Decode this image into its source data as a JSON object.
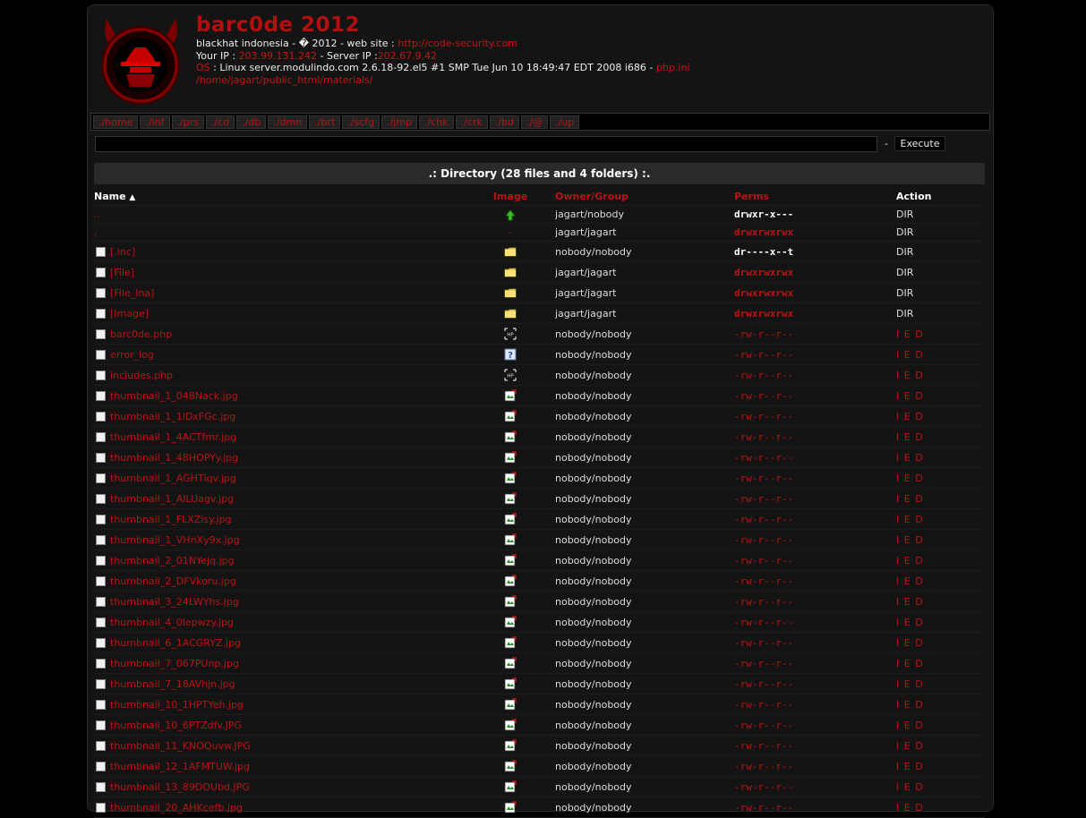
{
  "header": {
    "title": "barc0de 2012",
    "line1_prefix": "blackhat indonesia - � 2012 - web site : ",
    "line1_link": "http://code-security.com",
    "line2_label": "Your IP : ",
    "your_ip": "203.99.131.242",
    "line2_mid": " - Server IP :",
    "server_ip": "202.67.9.42",
    "os_label": "OS",
    "os_text": " : Linux server.modulindo.com 2.6.18-92.el5 #1 SMP Tue Jun 10 18:49:47 EDT 2008 i686 - ",
    "phpini": "php.ini",
    "path": "/home/jagart/public_html/materials/"
  },
  "nav": [
    "./home",
    "./inf",
    "./prs",
    "./cd",
    "./db",
    "./dmn",
    "./brt",
    "./scfg",
    "./jmp",
    "./chk",
    "./crk",
    "./bd",
    "./@",
    "./up"
  ],
  "command": {
    "value": "",
    "dash": "-",
    "execute_label": "Execute"
  },
  "directory_banner": ".: Directory (28 files and 4 folders) :.",
  "columns": {
    "name": "Name",
    "sort_indicator": "▲",
    "image": "Image",
    "owner": "Owner/Group",
    "perms": "Perms",
    "action": "Action"
  },
  "rows": [
    {
      "name": "..",
      "checkbox": false,
      "icon": "up-arrow-icon",
      "owner": "jagart/nobody",
      "perms": "drwxr-x---",
      "perm_style": "w",
      "action": "DIR"
    },
    {
      "name": ".",
      "checkbox": false,
      "icon": "dash",
      "icon_text": "-",
      "owner": "jagart/jagart",
      "perms": "drwxrwxrwx",
      "perm_style": "rb",
      "action": "DIR"
    },
    {
      "name": "[.inc]",
      "checkbox": true,
      "icon": "folder-icon",
      "owner": "nobody/nobody",
      "perms": "dr----x--t",
      "perm_style": "w",
      "action": "DIR"
    },
    {
      "name": "[File]",
      "checkbox": true,
      "icon": "folder-icon",
      "owner": "jagart/jagart",
      "perms": "drwxrwxrwx",
      "perm_style": "rb",
      "action": "DIR"
    },
    {
      "name": "[File_Ina]",
      "checkbox": true,
      "icon": "folder-icon",
      "owner": "jagart/jagart",
      "perms": "drwxrwxrwx",
      "perm_style": "rb",
      "action": "DIR"
    },
    {
      "name": "[Image]",
      "checkbox": true,
      "icon": "folder-icon",
      "owner": "jagart/jagart",
      "perms": "drwxrwxrwx",
      "perm_style": "rb",
      "action": "DIR"
    },
    {
      "name": "barc0de.php",
      "checkbox": true,
      "icon": "php-file-icon",
      "owner": "nobody/nobody",
      "perms": "-rw-r--r--",
      "perm_style": "r",
      "action": "I E D"
    },
    {
      "name": "error_log",
      "checkbox": true,
      "icon": "unknown-file-icon",
      "owner": "nobody/nobody",
      "perms": "-rw-r--r--",
      "perm_style": "r",
      "action": "I E D"
    },
    {
      "name": "includes.php",
      "checkbox": true,
      "icon": "php-file-icon",
      "owner": "nobody/nobody",
      "perms": "-rw-r--r--",
      "perm_style": "r",
      "action": "I E D"
    },
    {
      "name": "thumbnail_1_048Nack.jpg",
      "checkbox": true,
      "icon": "image-file-icon",
      "owner": "nobody/nobody",
      "perms": "-rw-r--r--",
      "perm_style": "r",
      "action": "I E D"
    },
    {
      "name": "thumbnail_1_1lDxFGc.jpg",
      "checkbox": true,
      "icon": "image-file-icon",
      "owner": "nobody/nobody",
      "perms": "-rw-r--r--",
      "perm_style": "r",
      "action": "I E D"
    },
    {
      "name": "thumbnail_1_4ACTfmr.jpg",
      "checkbox": true,
      "icon": "image-file-icon",
      "owner": "nobody/nobody",
      "perms": "-rw-r--r--",
      "perm_style": "r",
      "action": "I E D"
    },
    {
      "name": "thumbnail_1_48HOPYy.jpg",
      "checkbox": true,
      "icon": "image-file-icon",
      "owner": "nobody/nobody",
      "perms": "-rw-r--r--",
      "perm_style": "r",
      "action": "I E D"
    },
    {
      "name": "thumbnail_1_AGHTlqv.jpg",
      "checkbox": true,
      "icon": "image-file-icon",
      "owner": "nobody/nobody",
      "perms": "-rw-r--r--",
      "perm_style": "r",
      "action": "I E D"
    },
    {
      "name": "thumbnail_1_AILUagv.jpg",
      "checkbox": true,
      "icon": "image-file-icon",
      "owner": "nobody/nobody",
      "perms": "-rw-r--r--",
      "perm_style": "r",
      "action": "I E D"
    },
    {
      "name": "thumbnail_1_FLXZisy.jpg",
      "checkbox": true,
      "icon": "image-file-icon",
      "owner": "nobody/nobody",
      "perms": "-rw-r--r--",
      "perm_style": "r",
      "action": "I E D"
    },
    {
      "name": "thumbnail_1_VHnXy9x.jpg",
      "checkbox": true,
      "icon": "image-file-icon",
      "owner": "nobody/nobody",
      "perms": "-rw-r--r--",
      "perm_style": "r",
      "action": "I E D"
    },
    {
      "name": "thumbnail_2_01NYejq.jpg",
      "checkbox": true,
      "icon": "image-file-icon",
      "owner": "nobody/nobody",
      "perms": "-rw-r--r--",
      "perm_style": "r",
      "action": "I E D"
    },
    {
      "name": "thumbnail_2_DFVkoru.jpg",
      "checkbox": true,
      "icon": "image-file-icon",
      "owner": "nobody/nobody",
      "perms": "-rw-r--r--",
      "perm_style": "r",
      "action": "I E D"
    },
    {
      "name": "thumbnail_3_24LWYhs.jpg",
      "checkbox": true,
      "icon": "image-file-icon",
      "owner": "nobody/nobody",
      "perms": "-rw-r--r--",
      "perm_style": "r",
      "action": "I E D"
    },
    {
      "name": "thumbnail_4_0Iepwzy.jpg",
      "checkbox": true,
      "icon": "image-file-icon",
      "owner": "nobody/nobody",
      "perms": "-rw-r--r--",
      "perm_style": "r",
      "action": "I E D"
    },
    {
      "name": "thumbnail_6_1ACGRYZ.jpg",
      "checkbox": true,
      "icon": "image-file-icon",
      "owner": "nobody/nobody",
      "perms": "-rw-r--r--",
      "perm_style": "r",
      "action": "I E D"
    },
    {
      "name": "thumbnail_7_067PUnp.jpg",
      "checkbox": true,
      "icon": "image-file-icon",
      "owner": "nobody/nobody",
      "perms": "-rw-r--r--",
      "perm_style": "r",
      "action": "I E D"
    },
    {
      "name": "thumbnail_7_18AVhjn.jpg",
      "checkbox": true,
      "icon": "image-file-icon",
      "owner": "nobody/nobody",
      "perms": "-rw-r--r--",
      "perm_style": "r",
      "action": "I E D"
    },
    {
      "name": "thumbnail_10_1HPTYeh.jpg",
      "checkbox": true,
      "icon": "image-file-icon",
      "owner": "nobody/nobody",
      "perms": "-rw-r--r--",
      "perm_style": "r",
      "action": "I E D"
    },
    {
      "name": "thumbnail_10_6PTZdfv.JPG",
      "checkbox": true,
      "icon": "image-file-icon",
      "owner": "nobody/nobody",
      "perms": "-rw-r--r--",
      "perm_style": "r",
      "action": "I E D"
    },
    {
      "name": "thumbnail_11_KNOQuvw.JPG",
      "checkbox": true,
      "icon": "image-file-icon",
      "owner": "nobody/nobody",
      "perms": "-rw-r--r--",
      "perm_style": "r",
      "action": "I E D"
    },
    {
      "name": "thumbnail_12_1AFMTUW.jpg",
      "checkbox": true,
      "icon": "image-file-icon",
      "owner": "nobody/nobody",
      "perms": "-rw-r--r--",
      "perm_style": "r",
      "action": "I E D"
    },
    {
      "name": "thumbnail_13_89DOUbd.JPG",
      "checkbox": true,
      "icon": "image-file-icon",
      "owner": "nobody/nobody",
      "perms": "-rw-r--r--",
      "perm_style": "r",
      "action": "I E D"
    },
    {
      "name": "thumbnail_20_AHKcefb.jpg",
      "checkbox": true,
      "icon": "image-file-icon",
      "owner": "nobody/nobody",
      "perms": "-rw-r--r--",
      "perm_style": "r",
      "action": "I E D"
    }
  ],
  "colors": {
    "accent_red": "#b71515",
    "title_red": "#b01010",
    "background": "#000000",
    "panel": "#141414"
  }
}
